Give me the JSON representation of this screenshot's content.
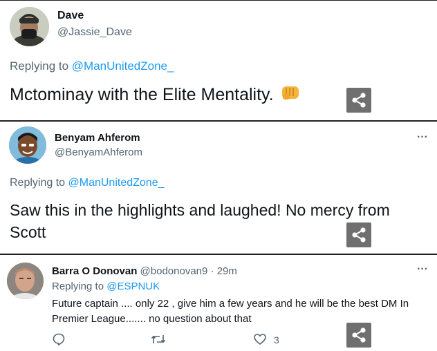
{
  "tweets": [
    {
      "name": "Dave",
      "handle": "@Jassie_Dave",
      "replying_prefix": "Replying to ",
      "replying_to": "@ManUnitedZone_",
      "text": "Mctominay with the Elite Mentality.",
      "emoji": "fist-emoji"
    },
    {
      "name": "Benyam Ahferom",
      "handle": "@BenyamAhferom",
      "more": "···",
      "replying_prefix": "Replying to ",
      "replying_to": "@ManUnitedZone_",
      "text_line1": "Saw this in the highlights and laughed! No mercy from",
      "text_line2": "Scott"
    },
    {
      "name": "Barra O Donovan",
      "handle": "@bodonovan9",
      "time": " · 29m",
      "more": "···",
      "replying_prefix": "Replying to ",
      "replying_to": "@ESPNUK",
      "text_line1": "Future captain .... only 22 , give him a few years and he will be the best DM In",
      "text_line2": "Premier League....... no question about that",
      "like_count": "3"
    }
  ],
  "icons": {
    "share": "share-icon",
    "reply": "reply-icon",
    "retweet": "retweet-icon",
    "like": "heart-icon"
  },
  "colors": {
    "link": "#1d9bf0",
    "secondary": "#536471",
    "share_bg": "#6f6f6f"
  }
}
